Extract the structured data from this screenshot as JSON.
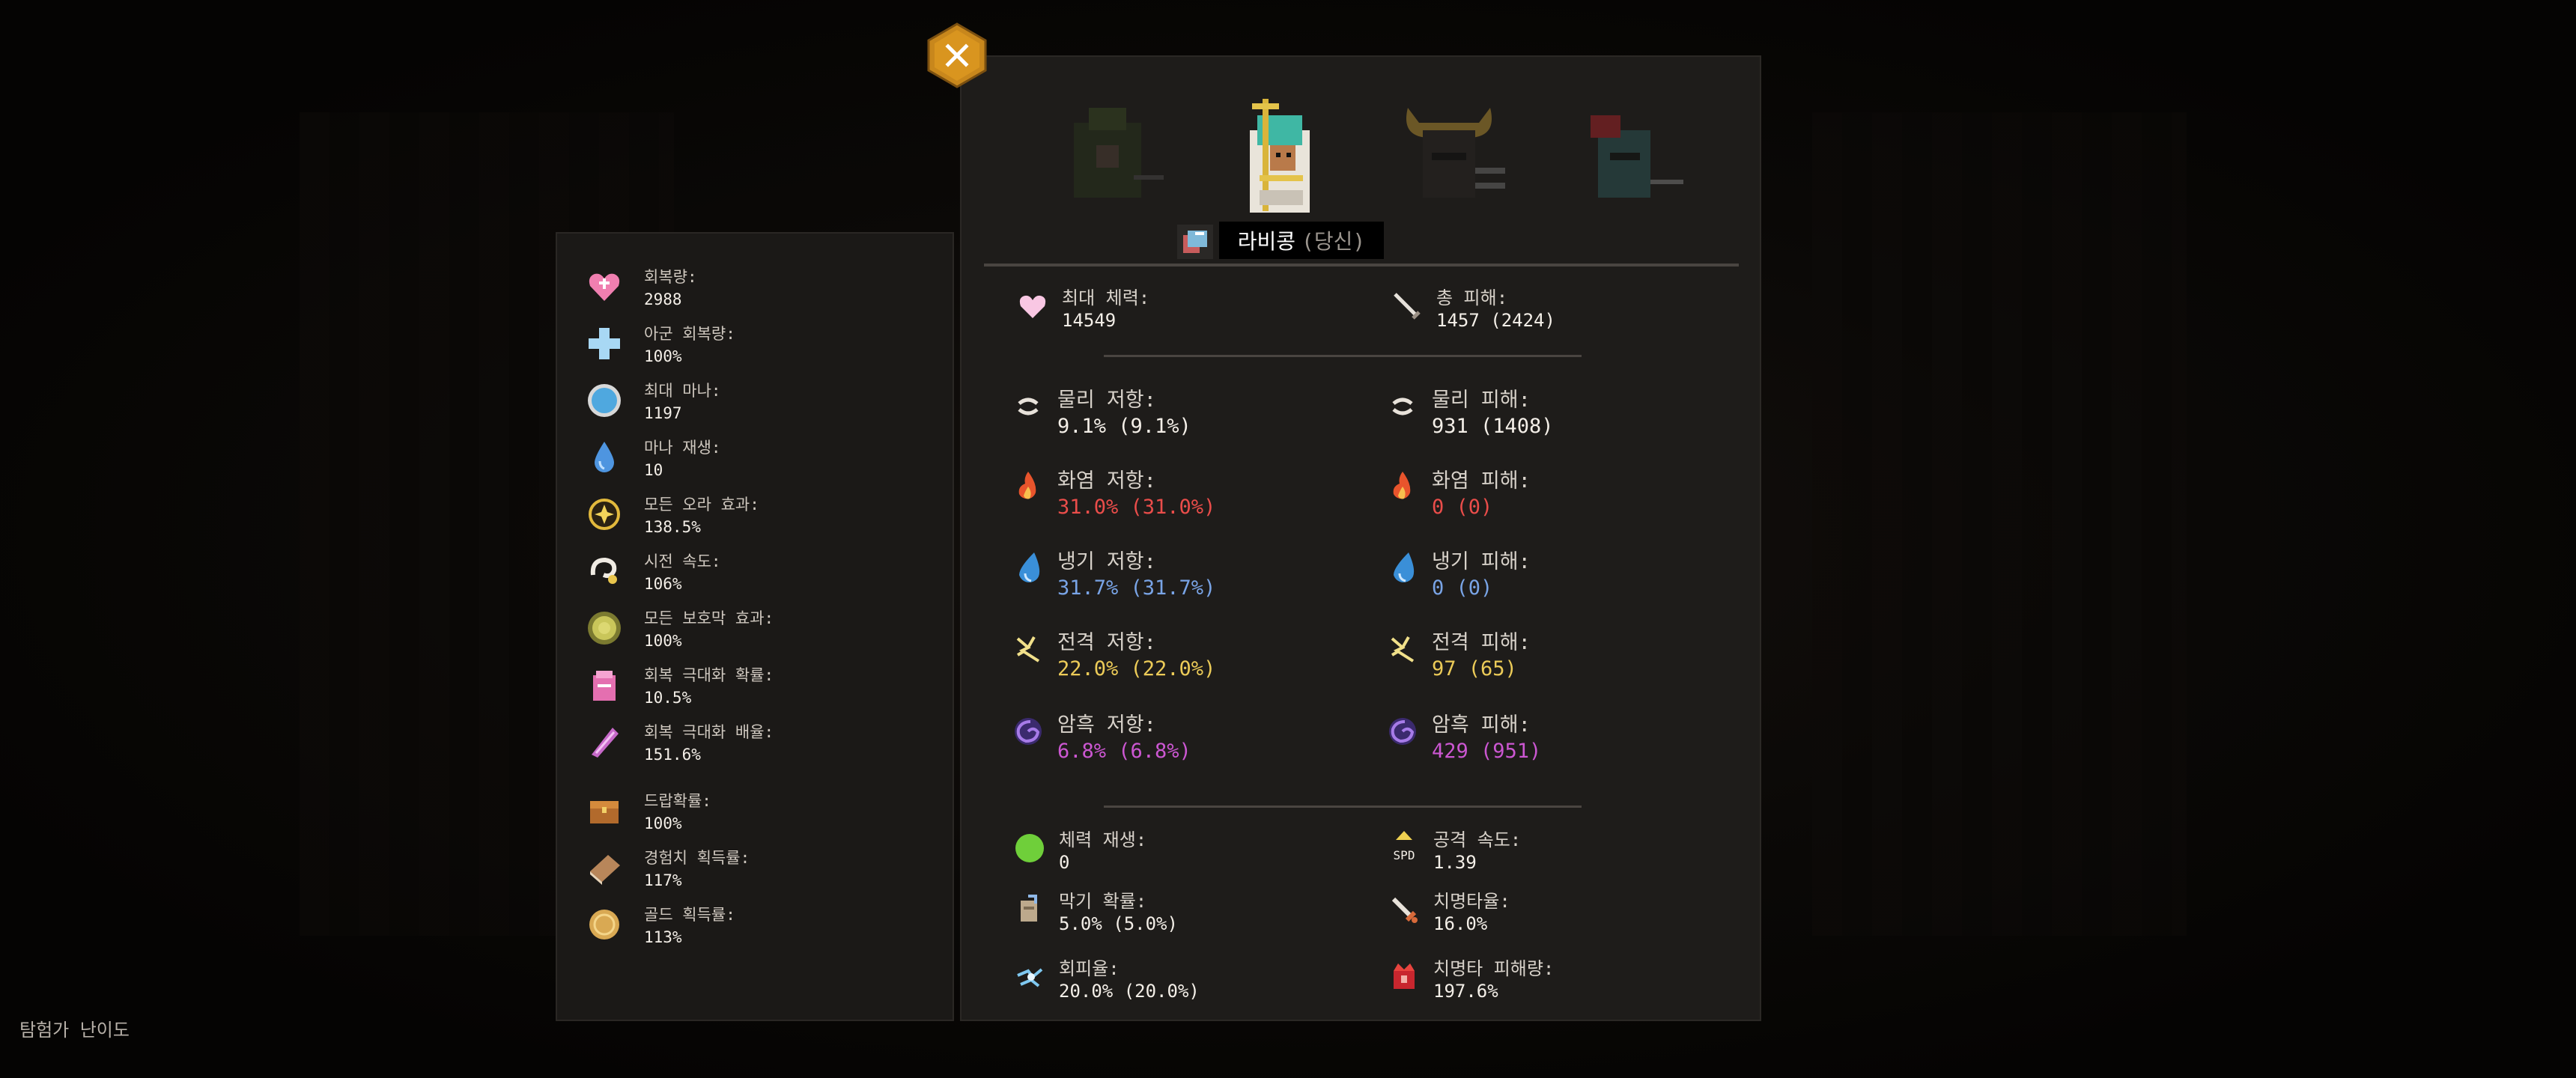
{
  "footer": {
    "difficulty_label": "탐험가 난이도"
  },
  "character": {
    "name": "라비콩",
    "you_tag": "(당신)"
  },
  "close_icon": "close-icon",
  "top_stats": {
    "max_hp": {
      "label": "최대 체력:",
      "value": "14549"
    },
    "total_damage": {
      "label": "총 피해:",
      "value": "1457 (2424)"
    }
  },
  "resistances": [
    {
      "key": "physical",
      "res_label": "물리 저항:",
      "res_value": "9.1% (9.1%)",
      "dmg_label": "물리 피해:",
      "dmg_value": "931 (1408)",
      "color": "#f4efe8"
    },
    {
      "key": "fire",
      "res_label": "화염 저항:",
      "res_value": "31.0% (31.0%)",
      "dmg_label": "화염 피해:",
      "dmg_value": "0 (0)",
      "color": "#ea4d4a"
    },
    {
      "key": "cold",
      "res_label": "냉기 저항:",
      "res_value": "31.7% (31.7%)",
      "dmg_label": "냉기 피해:",
      "dmg_value": "0 (0)",
      "color": "#79a4e6"
    },
    {
      "key": "lightning",
      "res_label": "전격 저항:",
      "res_value": "22.0% (22.0%)",
      "dmg_label": "전격 피해:",
      "dmg_value": "97 (65)",
      "color": "#eccb58"
    },
    {
      "key": "dark",
      "res_label": "암흑 저항:",
      "res_value": "6.8% (6.8%)",
      "dmg_label": "암흑 피해:",
      "dmg_value": "429 (951)",
      "color": "#cc57d2"
    }
  ],
  "bottom_stats": {
    "hp_regen": {
      "label": "체력 재생:",
      "value": "0"
    },
    "attack_speed": {
      "label": "공격 속도:",
      "value": "1.39",
      "icon_text": "SPD"
    },
    "block_chance": {
      "label": "막기 확률:",
      "value": "5.0% (5.0%)"
    },
    "crit_rate": {
      "label": "치명타율:",
      "value": "16.0%"
    },
    "evasion": {
      "label": "회피율:",
      "value": "20.0% (20.0%)"
    },
    "crit_damage": {
      "label": "치명타 피해량:",
      "value": "197.6%"
    }
  },
  "side_stats": [
    {
      "label": "회복량:",
      "value": "2988",
      "icon": "heal-heart-icon"
    },
    {
      "label": "아군 회복량:",
      "value": "100%",
      "icon": "cross-icon"
    },
    {
      "label": "최대 마나:",
      "value": "1197",
      "icon": "mana-orb-icon"
    },
    {
      "label": "마나 재생:",
      "value": "10",
      "icon": "mana-drop-icon"
    },
    {
      "label": "모든 오라 효과:",
      "value": "138.5%",
      "icon": "aura-icon"
    },
    {
      "label": "시전 속도:",
      "value": "106%",
      "icon": "cast-swirl-icon"
    },
    {
      "label": "모든 보호막 효과:",
      "value": "100%",
      "icon": "shield-orb-icon"
    },
    {
      "label": "회복 극대화 확률:",
      "value": "10.5%",
      "icon": "heal-crit-chance-icon"
    },
    {
      "label": "회복 극대화 배율:",
      "value": "151.6%",
      "icon": "heal-crit-multiplier-icon"
    },
    {
      "label": "드랍확률:",
      "value": "100%",
      "icon": "chest-icon"
    },
    {
      "label": "경험치 획득률:",
      "value": "117%",
      "icon": "book-icon"
    },
    {
      "label": "골드 획득률:",
      "value": "113%",
      "icon": "gold-coin-icon"
    }
  ]
}
